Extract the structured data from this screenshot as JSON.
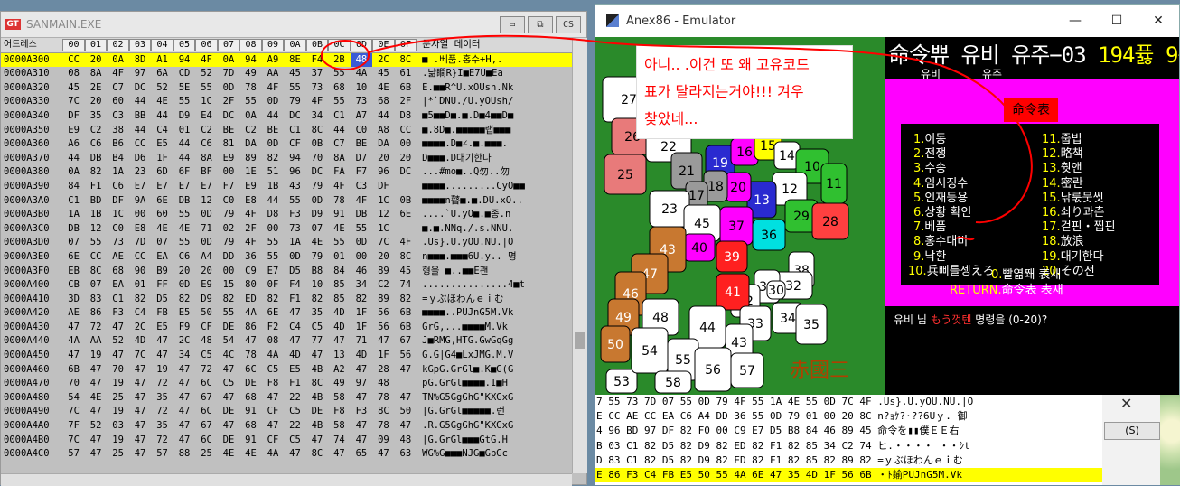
{
  "hex_window": {
    "title": "SANMAIN.EXE",
    "logo": "GT",
    "buttons": [
      "▭",
      "⧉",
      "CS"
    ],
    "header": {
      "addr": "어드레스",
      "cols": [
        "00",
        "01",
        "02",
        "03",
        "04",
        "05",
        "06",
        "07",
        "08",
        "09",
        "0A",
        "0B",
        "0C",
        "0D",
        "0E",
        "0F"
      ],
      "ascii": "문자열 데이터"
    },
    "rows": [
      {
        "addr": "0000A300",
        "bytes": [
          "CC",
          "20",
          "0A",
          "8D",
          "A1",
          "94",
          "4F",
          "0A",
          "94",
          "A9",
          "8E",
          "F4",
          "2B",
          "48",
          "2C",
          "8C"
        ],
        "ascii": "■ .베품.홍수+H,.",
        "selected": true
      },
      {
        "addr": "0000A310",
        "bytes": [
          "08",
          "8A",
          "4F",
          "97",
          "6A",
          "CD",
          "52",
          "7D",
          "49",
          "AA",
          "45",
          "37",
          "55",
          "4A",
          "45",
          "61"
        ],
        "ascii": ".냚瞷R}I■E7U■Ea"
      },
      {
        "addr": "0000A320",
        "bytes": [
          "45",
          "2E",
          "C7",
          "DC",
          "52",
          "5E",
          "55",
          "0D",
          "78",
          "4F",
          "55",
          "73",
          "68",
          "10",
          "4E",
          "6B"
        ],
        "ascii": "E.■■R^U.xOUsh.Nk"
      },
      {
        "addr": "0000A330",
        "bytes": [
          "7C",
          "20",
          "60",
          "44",
          "4E",
          "55",
          "1C",
          "2F",
          "55",
          "0D",
          "79",
          "4F",
          "55",
          "73",
          "68",
          "2F"
        ],
        "ascii": "|*`DNU./U.yOUsh/"
      },
      {
        "addr": "0000A340",
        "bytes": [
          "DF",
          "35",
          "C3",
          "BB",
          "44",
          "D9",
          "E4",
          "DC",
          "0A",
          "44",
          "DC",
          "34",
          "C1",
          "A7",
          "44",
          "D8"
        ],
        "ascii": "■5■■D■.■.D■4■■D■"
      },
      {
        "addr": "0000A350",
        "bytes": [
          "E9",
          "C2",
          "38",
          "44",
          "C4",
          "01",
          "C2",
          "BE",
          "C2",
          "BE",
          "C1",
          "8C",
          "44",
          "C0",
          "A8",
          "CC"
        ],
        "ascii": "■.8D■.■■■■■랩■■■"
      },
      {
        "addr": "0000A360",
        "bytes": [
          "A6",
          "C6",
          "B6",
          "CC",
          "E5",
          "44",
          "C6",
          "81",
          "DA",
          "0D",
          "CF",
          "0B",
          "C7",
          "BE",
          "DA",
          "00"
        ],
        "ascii": "■■■■.D■∠.■.■■■."
      },
      {
        "addr": "0000A370",
        "bytes": [
          "44",
          "DB",
          "B4",
          "D6",
          "1F",
          "44",
          "8A",
          "E9",
          "89",
          "82",
          "94",
          "70",
          "8A",
          "D7",
          "20",
          "20"
        ],
        "ascii": "D■■■.D대기한다"
      },
      {
        "addr": "0000A380",
        "bytes": [
          "0A",
          "82",
          "1A",
          "23",
          "6D",
          "6F",
          "BF",
          "00",
          "1E",
          "51",
          "96",
          "DC",
          "FA",
          "F7",
          "96",
          "DC"
        ],
        "ascii": "...#mo■..Q勿..勿"
      },
      {
        "addr": "0000A390",
        "bytes": [
          "84",
          "F1",
          "C6",
          "E7",
          "E7",
          "E7",
          "E7",
          "F7",
          "E9",
          "1B",
          "43",
          "79",
          "4F",
          "C3",
          "DF"
        ],
        "ascii": "■■■■.........CyO■■"
      },
      {
        "addr": "0000A3A0",
        "bytes": [
          "C1",
          "BD",
          "DF",
          "9A",
          "6E",
          "DB",
          "12",
          "C0",
          "E8",
          "44",
          "55",
          "0D",
          "78",
          "4F",
          "1C",
          "0B"
        ],
        "ascii": "■■■■n瞽■.■.DU.xO.."
      },
      {
        "addr": "0000A3B0",
        "bytes": [
          "1A",
          "1B",
          "1C",
          "00",
          "60",
          "55",
          "0D",
          "79",
          "4F",
          "D8",
          "F3",
          "D9",
          "91",
          "DB",
          "12",
          "6E"
        ],
        "ascii": "....`U.yO■.■종.n"
      },
      {
        "addr": "0000A3C0",
        "bytes": [
          "DB",
          "12",
          "C0",
          "E8",
          "4E",
          "4E",
          "71",
          "02",
          "2F",
          "00",
          "73",
          "07",
          "4E",
          "55",
          "1C"
        ],
        "ascii": "■.■.NNq./.s.NNU."
      },
      {
        "addr": "0000A3D0",
        "bytes": [
          "07",
          "55",
          "73",
          "7D",
          "07",
          "55",
          "0D",
          "79",
          "4F",
          "55",
          "1A",
          "4E",
          "55",
          "0D",
          "7C",
          "4F"
        ],
        "ascii": ".Us}.U.yOU.NU.|O"
      },
      {
        "addr": "0000A3E0",
        "bytes": [
          "6E",
          "CC",
          "AE",
          "CC",
          "EA",
          "C6",
          "A4",
          "DD",
          "36",
          "55",
          "0D",
          "79",
          "01",
          "00",
          "20",
          "8C"
        ],
        "ascii": "n■■■.■■■6U.y.. 명"
      },
      {
        "addr": "0000A3F0",
        "bytes": [
          "EB",
          "8C",
          "68",
          "90",
          "B9",
          "20",
          "20",
          "00",
          "C9",
          "E7",
          "D5",
          "B8",
          "84",
          "46",
          "89",
          "45"
        ],
        "ascii": "    형을  ■..■■E괜"
      },
      {
        "addr": "0000A400",
        "bytes": [
          "CB",
          "07",
          "EA",
          "01",
          "FF",
          "0D",
          "E9",
          "15",
          "80",
          "0F",
          "F4",
          "10",
          "85",
          "34",
          "C2",
          "74"
        ],
        "ascii": "...............4■t"
      },
      {
        "addr": "0000A410",
        "bytes": [
          "3D",
          "83",
          "C1",
          "82",
          "D5",
          "82",
          "D9",
          "82",
          "ED",
          "82",
          "F1",
          "82",
          "85",
          "82",
          "89",
          "82"
        ],
        "ascii": "=ｙぶほわんｅｉむ"
      },
      {
        "addr": "0000A420",
        "bytes": [
          "AE",
          "86",
          "F3",
          "C4",
          "FB",
          "E5",
          "50",
          "55",
          "4A",
          "6E",
          "47",
          "35",
          "4D",
          "1F",
          "56",
          "6B"
        ],
        "ascii": "■■■■..PUJnG5M.Vk"
      },
      {
        "addr": "0000A430",
        "bytes": [
          "47",
          "72",
          "47",
          "2C",
          "E5",
          "F9",
          "CF",
          "DE",
          "86",
          "F2",
          "C4",
          "C5",
          "4D",
          "1F",
          "56",
          "6B"
        ],
        "ascii": "GrG,...■■■■M.Vk"
      },
      {
        "addr": "0000A440",
        "bytes": [
          "4A",
          "AA",
          "52",
          "4D",
          "47",
          "2C",
          "48",
          "54",
          "47",
          "08",
          "47",
          "77",
          "47",
          "71",
          "47",
          "67"
        ],
        "ascii": "J■RMG,HTG.GwGqGg"
      },
      {
        "addr": "0000A450",
        "bytes": [
          "47",
          "19",
          "47",
          "7C",
          "47",
          "34",
          "C5",
          "4C",
          "78",
          "4A",
          "4D",
          "47",
          "13",
          "4D",
          "1F",
          "56"
        ],
        "ascii": "G.G|G4■LxJMG.M.V"
      },
      {
        "addr": "0000A460",
        "bytes": [
          "6B",
          "47",
          "70",
          "47",
          "19",
          "47",
          "72",
          "47",
          "6C",
          "C5",
          "E5",
          "4B",
          "A2",
          "47",
          "28",
          "47"
        ],
        "ascii": "kGpG.GrGl■.K■G(G"
      },
      {
        "addr": "0000A470",
        "bytes": [
          "70",
          "47",
          "19",
          "47",
          "72",
          "47",
          "6C",
          "C5",
          "DE",
          "F8",
          "F1",
          "8C",
          "49",
          "97",
          "48"
        ],
        "ascii": "pG.GrGl■■■■.I■H"
      },
      {
        "addr": "0000A480",
        "bytes": [
          "54",
          "4E",
          "25",
          "47",
          "35",
          "47",
          "67",
          "47",
          "68",
          "47",
          "22",
          "4B",
          "58",
          "47",
          "78",
          "47"
        ],
        "ascii": "TN%G5GgGhG\"KXGxG"
      },
      {
        "addr": "0000A490",
        "bytes": [
          "7C",
          "47",
          "19",
          "47",
          "72",
          "47",
          "6C",
          "DE",
          "91",
          "CF",
          "C5",
          "DE",
          "F8",
          "F3",
          "8C",
          "50"
        ],
        "ascii": "|G.GrGl■■■■■.런"
      },
      {
        "addr": "0000A4A0",
        "bytes": [
          "7F",
          "52",
          "03",
          "47",
          "35",
          "47",
          "67",
          "47",
          "68",
          "47",
          "22",
          "4B",
          "58",
          "47",
          "78",
          "47"
        ],
        "ascii": ".R.G5GgGhG\"KXGxG"
      },
      {
        "addr": "0000A4B0",
        "bytes": [
          "7C",
          "47",
          "19",
          "47",
          "72",
          "47",
          "6C",
          "DE",
          "91",
          "CF",
          "C5",
          "47",
          "74",
          "47",
          "09",
          "48"
        ],
        "ascii": "|G.GrGl■■■GtG.H"
      },
      {
        "addr": "0000A4C0",
        "bytes": [
          "57",
          "47",
          "25",
          "47",
          "57",
          "88",
          "25",
          "4E",
          "4E",
          "4A",
          "47",
          "8C",
          "47",
          "65",
          "47",
          "63"
        ],
        "ascii": "WG%G■■■NJG■GbGc"
      }
    ]
  },
  "emulator": {
    "title": "Anex86 - Emulator",
    "controls": [
      "—",
      "☐",
      "✕"
    ],
    "header": {
      "line_white": "命令쀼 유비 유주−03 ",
      "line_yellow": "194퓷 9륭",
      "sub_left": "유비",
      "sub_right": "유주"
    },
    "menu_title": "命令表",
    "menu_left": [
      {
        "n": "1.",
        "t": "이동"
      },
      {
        "n": "2.",
        "t": "전쟁"
      },
      {
        "n": "3.",
        "t": "수송"
      },
      {
        "n": "4.",
        "t": "임시징수"
      },
      {
        "n": "5.",
        "t": "인재등용"
      },
      {
        "n": "6.",
        "t": "상황 확인"
      },
      {
        "n": "7.",
        "t": "베품"
      },
      {
        "n": "8.",
        "t": "홍수대비"
      },
      {
        "n": "9.",
        "t": "낙환"
      },
      {
        "n": "10.",
        "t": "兵삐를젱えろ"
      }
    ],
    "menu_right": [
      {
        "n": "11.",
        "t": "줍빕"
      },
      {
        "n": "12.",
        "t": "略책"
      },
      {
        "n": "13.",
        "t": "췃앤"
      },
      {
        "n": "14.",
        "t": "密란"
      },
      {
        "n": "15.",
        "t": "낚룫뭇씻"
      },
      {
        "n": "16.",
        "t": "쇠り과츤"
      },
      {
        "n": "17.",
        "t": "겉핀・찝핀"
      },
      {
        "n": "18.",
        "t": "放浪"
      },
      {
        "n": "19.",
        "t": "대기한다"
      },
      {
        "n": "20.",
        "t": "その전"
      }
    ],
    "menu_foot1_yellow": "0.",
    "menu_foot1_white": "빨엶쫴 表새",
    "menu_foot2_yellow": "RETURN.",
    "menu_foot2_white": "命令表 表새",
    "prompt_a": "유비 님 ",
    "prompt_b": "もう껏텐",
    "prompt_c": " 명령을    (0-20)?",
    "map_caption": "赤國三",
    "provinces": [
      {
        "n": "27",
        "c": "#ffffff"
      },
      {
        "n": "26",
        "c": "#e87a7a"
      },
      {
        "n": "25",
        "c": "#e87a7a"
      },
      {
        "n": "22",
        "c": "#ffffff"
      },
      {
        "n": "21",
        "c": "#9a9a9a"
      },
      {
        "n": "19",
        "c": "#2a2ad0"
      },
      {
        "n": "16",
        "c": "#ff00ff"
      },
      {
        "n": "15",
        "c": "#ffff00"
      },
      {
        "n": "14",
        "c": "#ffffff"
      },
      {
        "n": "10",
        "c": "#30c030"
      },
      {
        "n": "11",
        "c": "#30c030"
      },
      {
        "n": "12",
        "c": "#ffffff"
      },
      {
        "n": "13",
        "c": "#2a2ad0"
      },
      {
        "n": "20",
        "c": "#ff00ff"
      },
      {
        "n": "18",
        "c": "#9a9a9a"
      },
      {
        "n": "17",
        "c": "#9a9a9a"
      },
      {
        "n": "23",
        "c": "#ffffff"
      },
      {
        "n": "45",
        "c": "#ffffff"
      },
      {
        "n": "37",
        "c": "#ff00ff"
      },
      {
        "n": "29",
        "c": "#30c030"
      },
      {
        "n": "28",
        "c": "#ff4040"
      },
      {
        "n": "36",
        "c": "#00e0e0"
      },
      {
        "n": "40",
        "c": "#ff00ff"
      },
      {
        "n": "39",
        "c": "#ff2020"
      },
      {
        "n": "43",
        "c": "#c87830"
      },
      {
        "n": "47",
        "c": "#c87830"
      },
      {
        "n": "46",
        "c": "#c87830"
      },
      {
        "n": "49",
        "c": "#c87830"
      },
      {
        "n": "50",
        "c": "#c87830"
      },
      {
        "n": "48",
        "c": "#ffffff"
      },
      {
        "n": "38",
        "c": "#ffffff"
      },
      {
        "n": "32",
        "c": "#ffffff"
      },
      {
        "n": "31",
        "c": "#ffffff"
      },
      {
        "n": "42",
        "c": "#ffffff"
      },
      {
        "n": "41",
        "c": "#ff2020"
      },
      {
        "n": "33",
        "c": "#ffffff"
      },
      {
        "n": "34",
        "c": "#ffffff"
      },
      {
        "n": "35",
        "c": "#ffffff"
      },
      {
        "n": "44",
        "c": "#ffffff"
      },
      {
        "n": "43b",
        "c": "#ffffff"
      },
      {
        "n": "30",
        "c": "#ffffff"
      },
      {
        "n": "53",
        "c": "#ffffff"
      },
      {
        "n": "54",
        "c": "#ffffff"
      },
      {
        "n": "55",
        "c": "#ffffff"
      },
      {
        "n": "56",
        "c": "#ffffff"
      },
      {
        "n": "57",
        "c": "#ffffff"
      },
      {
        "n": "58",
        "c": "#ffffff"
      }
    ]
  },
  "annotation": {
    "line1": "아니.. .이건 또 왜 고유코드",
    "line2": "표가 달라지는거야!!! 겨우",
    "line3": "찾았네..."
  },
  "background_window": {
    "rows": [
      {
        "text": "7 55 73 7D 07 55 0D 79 4F 55 1A 4E 55 0D 7C 4F  .Us}.U.yOU.NU.|O",
        "sel": false
      },
      {
        "text": "E CC AE CC EA C6 A4 DD 36 55 0D 79 01 00 20 8C  n?ｮｹ?·??6Uｙ. 御",
        "sel": false
      },
      {
        "text": "4 96 BD 97 DF 82 F0 00 C9 E7 D5 B8 84 46 89 45  命令を▮▮僕ＥＥ右",
        "sel": false
      },
      {
        "text": "B 03 C1 82 D5 82 D9 82 ED 82 F1 82 85 34 C2 74  ヒ.・・・・ ・・ｼt",
        "sel": false
      },
      {
        "text": "D 83 C1 82 D5 82 D9 82 ED 82 F1 82 85 82 89 82  =ｙぶほわんｅｉむ",
        "sel": false
      },
      {
        "text": "E 86 F3 C4 FB E5 50 55 4A 6E 47 35 4D 1F 56 6B     ・ﾄ鍮PUJnG5M.Vk",
        "sel": true
      }
    ],
    "button_label": "(S)",
    "close": "✕"
  }
}
